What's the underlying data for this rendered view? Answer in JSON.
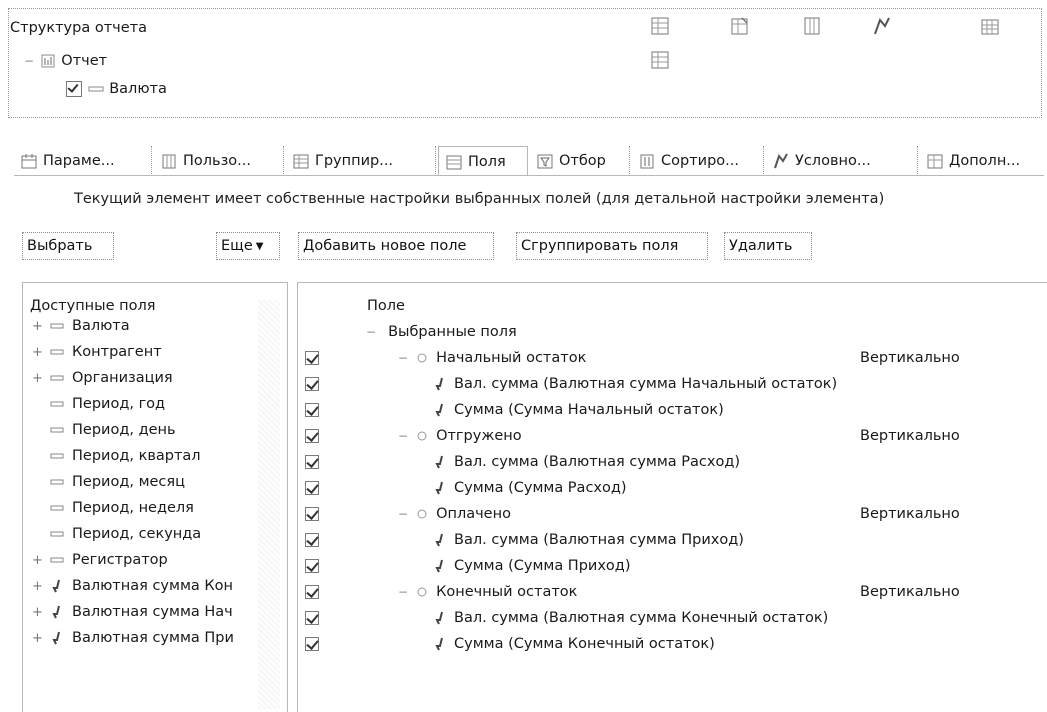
{
  "structure": {
    "title": "Структура отчета",
    "tree": [
      {
        "label": "Отчет"
      },
      {
        "label": "Валюта"
      }
    ]
  },
  "tabs": [
    {
      "label": "Параме..."
    },
    {
      "label": "Пользо..."
    },
    {
      "label": "Группир..."
    },
    {
      "label": "Поля"
    },
    {
      "label": "Отбор"
    },
    {
      "label": "Сортиро..."
    },
    {
      "label": "Условно..."
    },
    {
      "label": "Дополн..."
    }
  ],
  "info_text": "Текущий элемент имеет собственные настройки выбранных полей (для детальной настройки элемента)",
  "buttons": {
    "select": "Выбрать",
    "more": "Еще",
    "add_field": "Добавить новое поле",
    "group_fields": "Сгруппировать поля",
    "delete": "Удалить"
  },
  "available_fields": {
    "header": "Доступные поля",
    "items": [
      {
        "label": "Валюта",
        "icon": "field-icon"
      },
      {
        "label": "Контрагент",
        "icon": "field-icon"
      },
      {
        "label": "Организация",
        "icon": "field-icon"
      },
      {
        "label": "Период, год",
        "icon": "field-icon"
      },
      {
        "label": "Период, день",
        "icon": "field-icon"
      },
      {
        "label": "Период, квартал",
        "icon": "field-icon"
      },
      {
        "label": "Период, месяц",
        "icon": "field-icon"
      },
      {
        "label": "Период, неделя",
        "icon": "field-icon"
      },
      {
        "label": "Период, секунда",
        "icon": "field-icon"
      },
      {
        "label": "Регистратор",
        "icon": "field-icon"
      },
      {
        "label": "Валютная сумма Кон",
        "icon": "resource-icon"
      },
      {
        "label": "Валютная сумма Нач",
        "icon": "resource-icon"
      },
      {
        "label": "Валютная сумма При",
        "icon": "resource-icon"
      }
    ]
  },
  "selected_fields": {
    "header": "Поле",
    "root": "Выбранные поля",
    "rows": [
      {
        "label": "Начальный остаток",
        "placement": "Вертикально"
      },
      {
        "label": "Вал. сумма (Валютная сумма Начальный остаток)"
      },
      {
        "label": "Сумма (Сумма Начальный остаток)"
      },
      {
        "label": "Отгружено",
        "placement": "Вертикально"
      },
      {
        "label": "Вал. сумма (Валютная сумма Расход)"
      },
      {
        "label": "Сумма (Сумма Расход)"
      },
      {
        "label": "Оплачено",
        "placement": "Вертикально"
      },
      {
        "label": "Вал. сумма (Валютная сумма Приход)"
      },
      {
        "label": "Сумма (Сумма Приход)"
      },
      {
        "label": "Конечный остаток",
        "placement": "Вертикально"
      },
      {
        "label": "Вал. сумма (Валютная сумма Конечный остаток)"
      },
      {
        "label": "Сумма (Сумма Конечный остаток)"
      }
    ]
  }
}
